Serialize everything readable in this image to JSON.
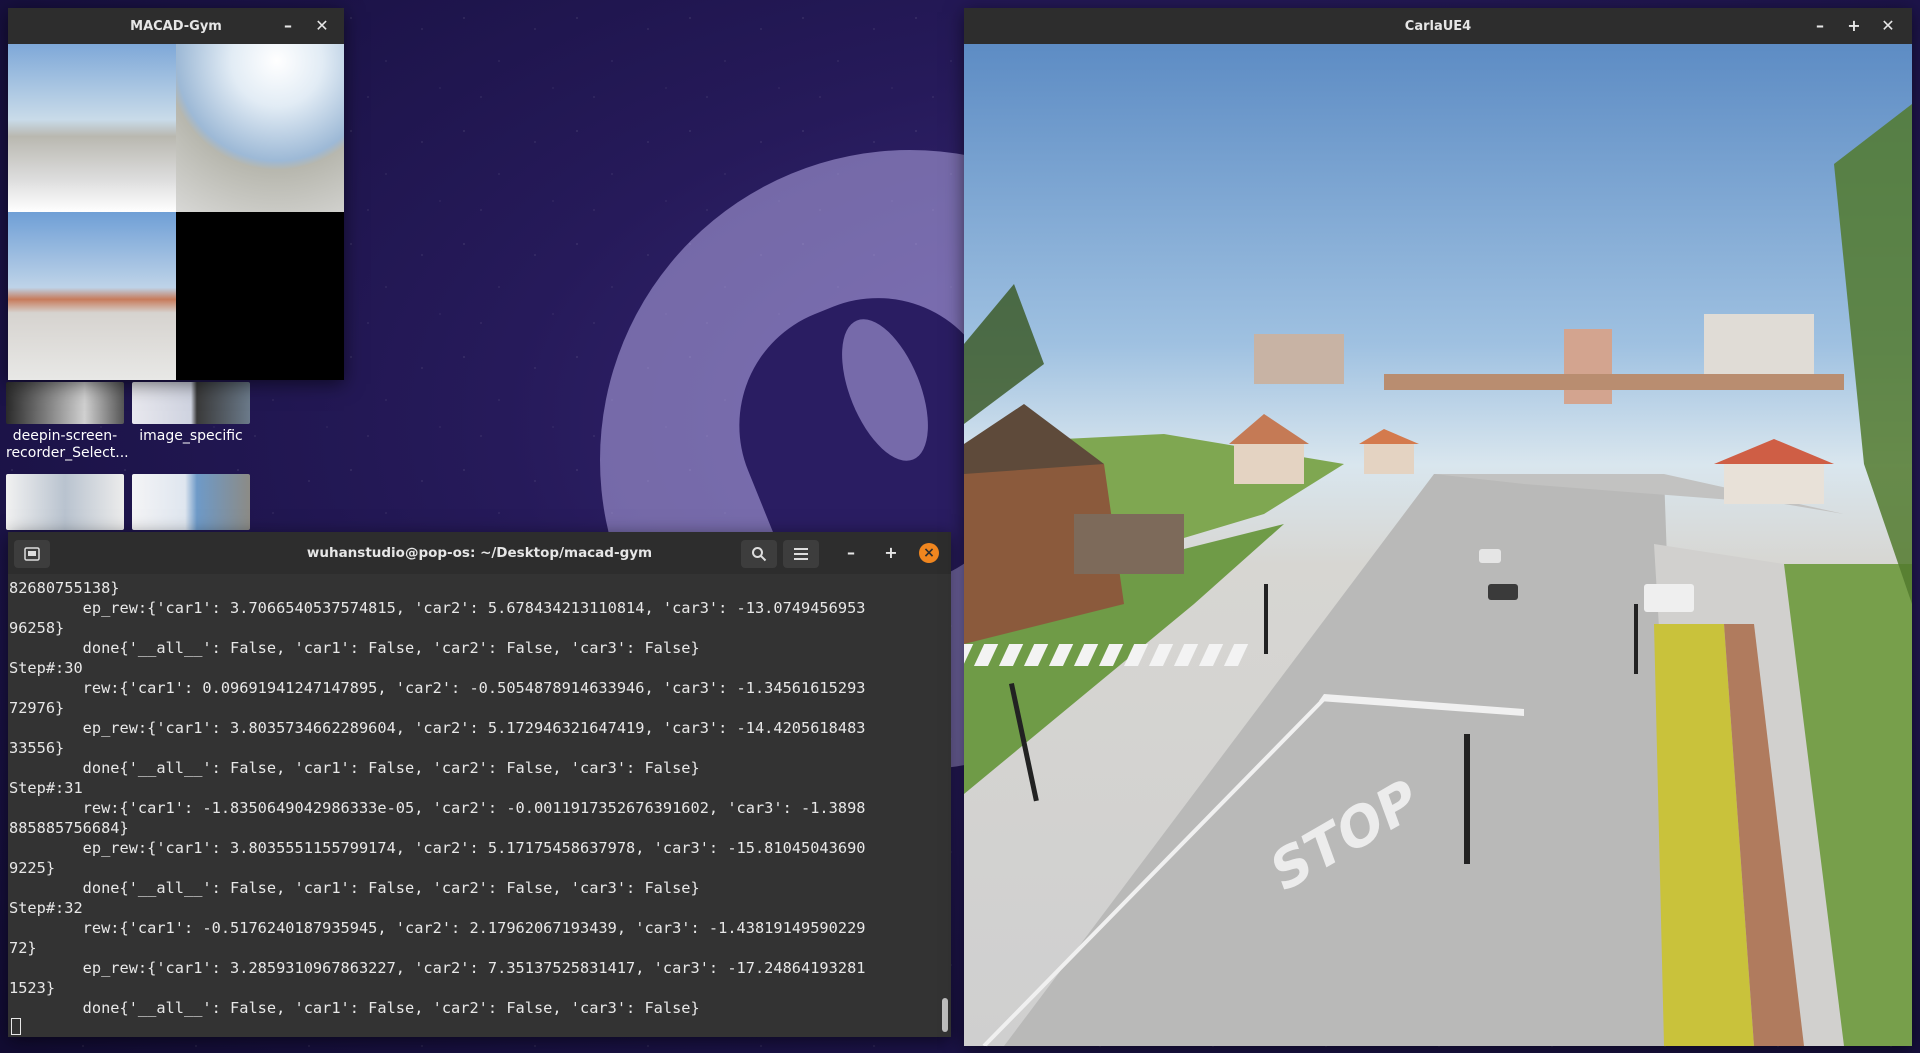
{
  "desktop": {
    "icons": [
      {
        "label": "deepin-screen-recorder_Select..."
      },
      {
        "label": "image_specific"
      },
      {
        "label": ""
      },
      {
        "label": ""
      }
    ]
  },
  "macad_window": {
    "title": "MACAD-Gym",
    "minimize": "–",
    "close": "✕"
  },
  "carla_window": {
    "title": "CarlaUE4",
    "minimize": "–",
    "maximize": "+",
    "close": "✕",
    "road_marking": "STOP"
  },
  "terminal": {
    "title": "wuhanstudio@pop-os: ~/Desktop/macad-gym",
    "minimize": "–",
    "maximize": "+",
    "close": "×",
    "lines": [
      "82680755138}",
      "        ep_rew:{'car1': 3.7066540537574815, 'car2': 5.678434213110814, 'car3': -13.0749456953",
      "96258}",
      "        done{'__all__': False, 'car1': False, 'car2': False, 'car3': False}",
      "Step#:30",
      "        rew:{'car1': 0.09691941247147895, 'car2': -0.5054878914633946, 'car3': -1.34561615293",
      "72976}",
      "        ep_rew:{'car1': 3.8035734662289604, 'car2': 5.172946321647419, 'car3': -14.4205618483",
      "33556}",
      "        done{'__all__': False, 'car1': False, 'car2': False, 'car3': False}",
      "Step#:31",
      "        rew:{'car1': -1.8350649042986333e-05, 'car2': -0.0011917352676391602, 'car3': -1.3898",
      "885885756684}",
      "        ep_rew:{'car1': 3.8035551155799174, 'car2': 5.17175458637978, 'car3': -15.81045043690",
      "9225}",
      "        done{'__all__': False, 'car1': False, 'car2': False, 'car3': False}",
      "Step#:32",
      "        rew:{'car1': -0.5176240187935945, 'car2': 2.17962067193439, 'car3': -1.43819149590229",
      "72}",
      "        ep_rew:{'car1': 3.2859310967863227, 'car2': 7.35137525831417, 'car3': -17.24864193281",
      "1523}",
      "        done{'__all__': False, 'car1': False, 'car2': False, 'car3': False}"
    ]
  }
}
